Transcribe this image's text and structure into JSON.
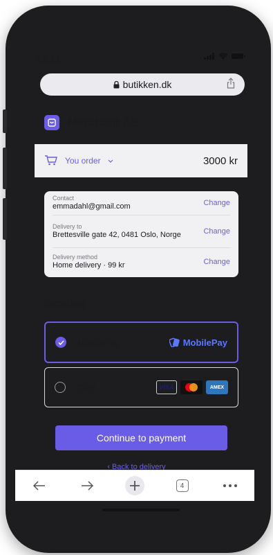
{
  "status": {
    "time": "13:12"
  },
  "browser": {
    "url": "butikken.dk"
  },
  "merchant": {
    "name": "Merchant AS"
  },
  "order": {
    "label": "You order",
    "total": "3000 kr"
  },
  "summary": {
    "rows": [
      {
        "label": "Contact",
        "value": "emmadahl@gmail.com",
        "action": "Change"
      },
      {
        "label": "Delivery to",
        "value": "Brettesville gate 42, 0481 Oslo, Norge",
        "action": "Change"
      },
      {
        "label": "Delivery method",
        "value": "Home delivery · 99 kr",
        "action": "Change"
      }
    ]
  },
  "payment": {
    "heading": "Betaling",
    "options": [
      {
        "label": "MobilePay",
        "brand": "MobilePay",
        "selected": true
      },
      {
        "label": "Card",
        "brands": [
          "VISA",
          "Mastercard",
          "AMEX"
        ],
        "selected": false
      }
    ]
  },
  "actions": {
    "continue_label": "Continue to payment",
    "back_label": "‹ Back to delivery"
  },
  "toolbar": {
    "tab_count": "4"
  },
  "colors": {
    "accent": "#6b5ce7",
    "mobilepay": "#5a78ff"
  }
}
